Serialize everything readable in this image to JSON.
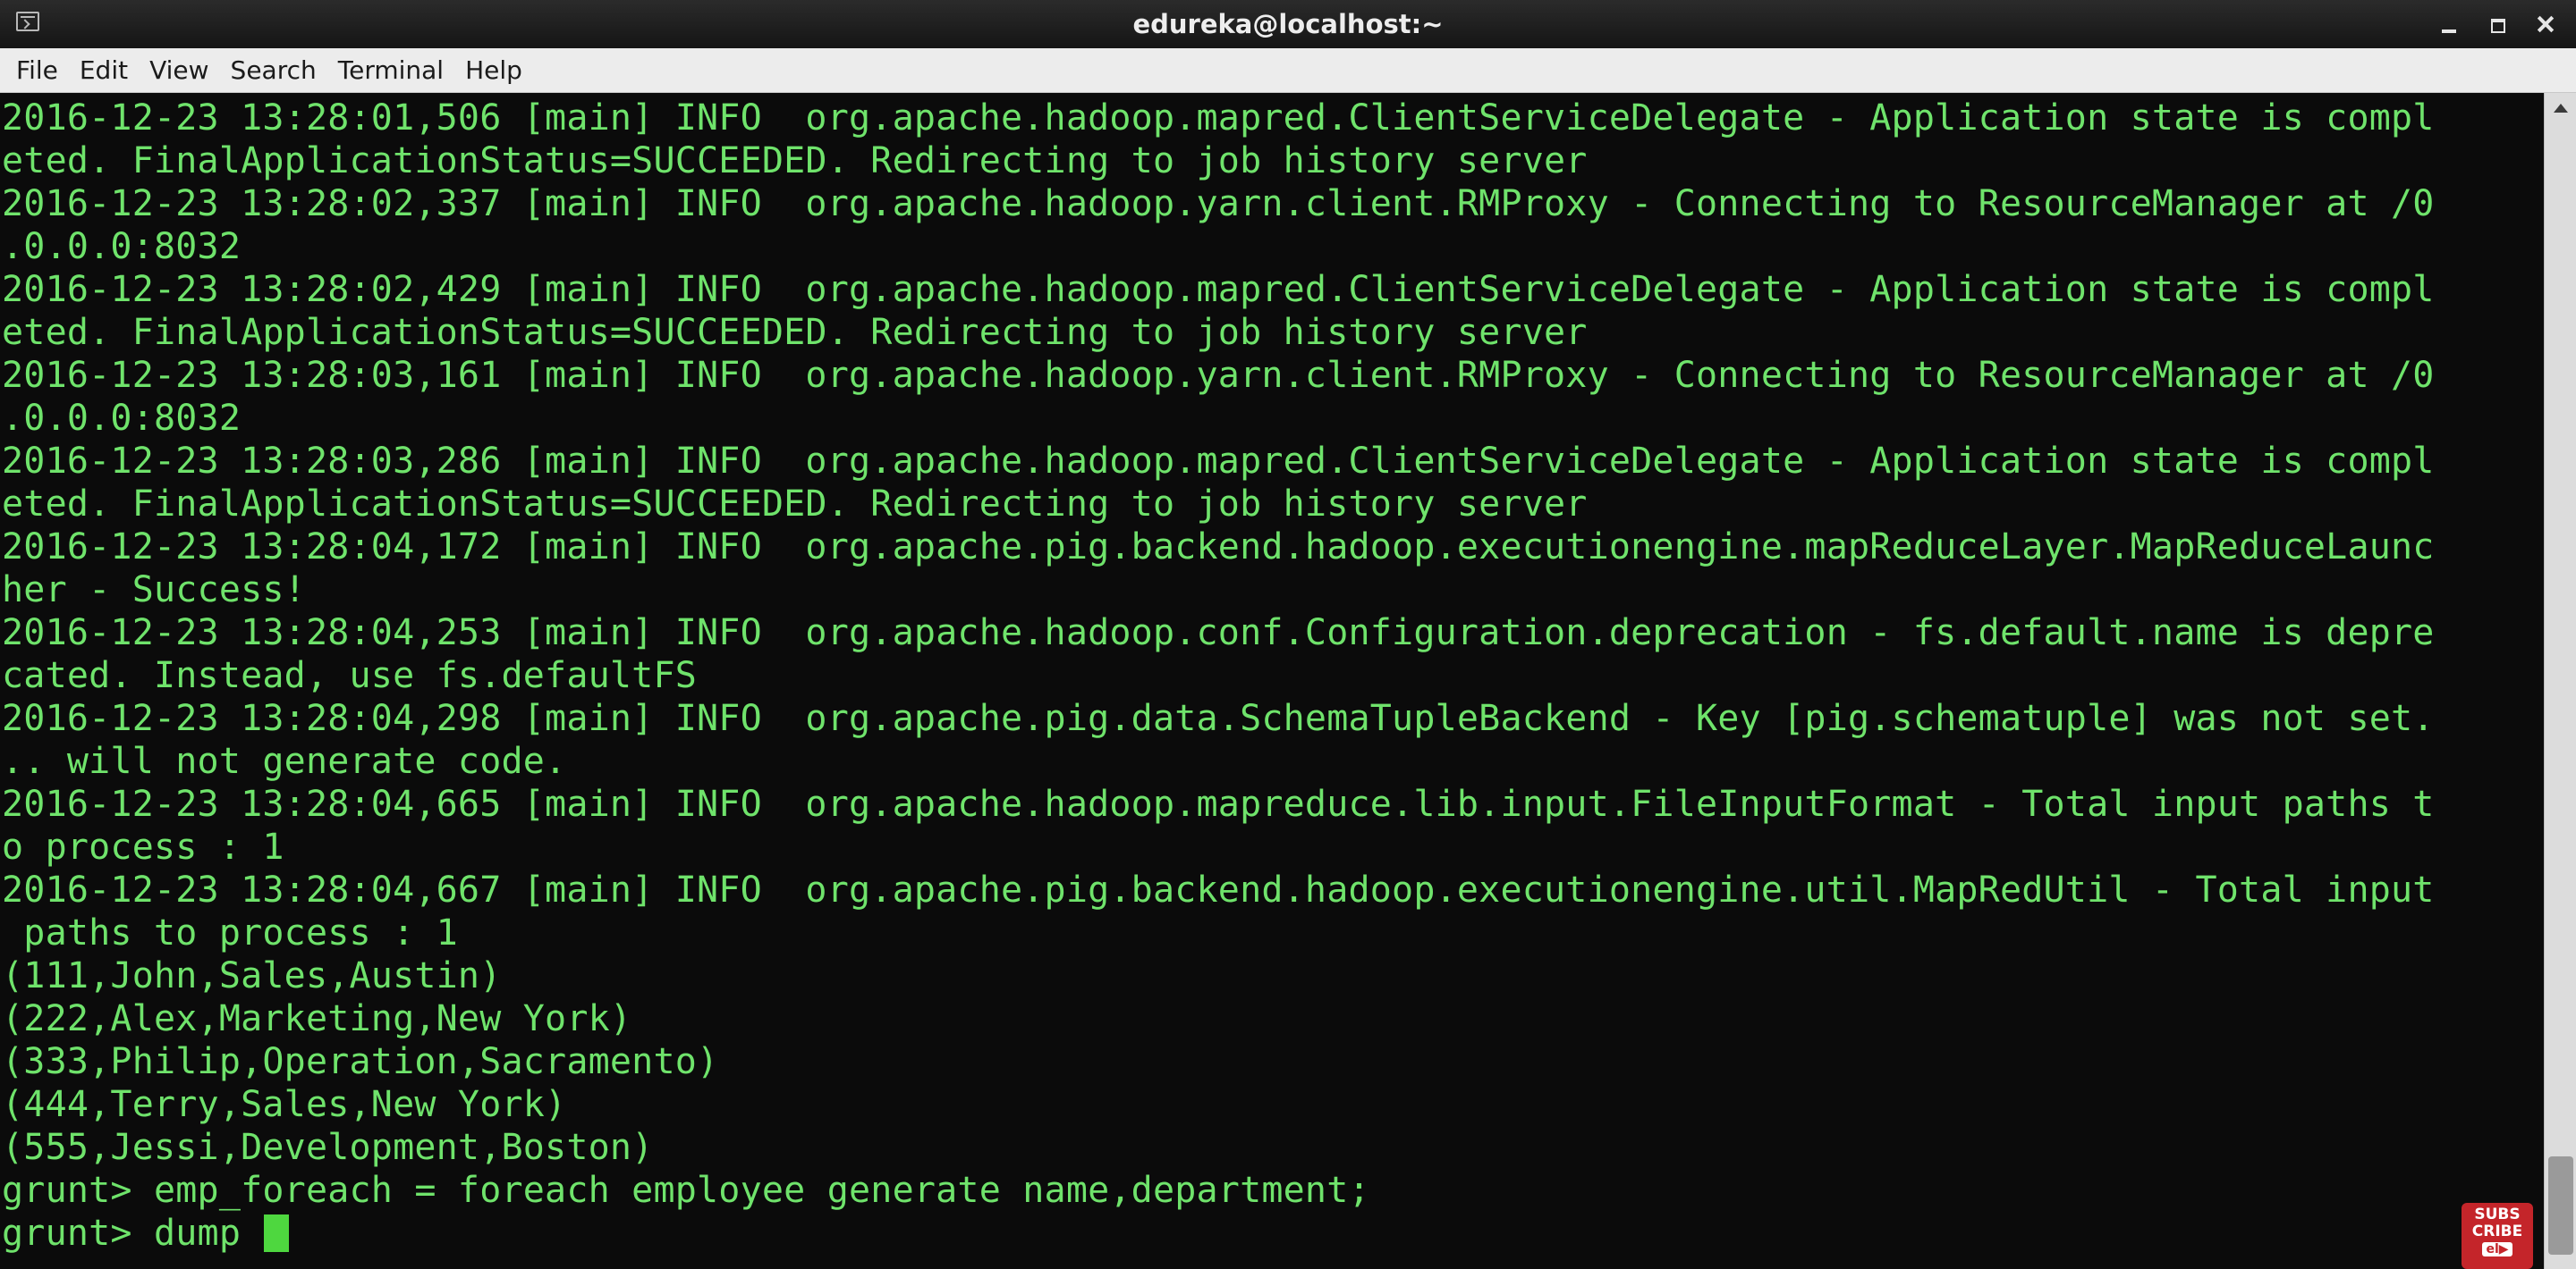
{
  "window": {
    "title": "edureka@localhost:~"
  },
  "menu": [
    "File",
    "Edit",
    "View",
    "Search",
    "Terminal",
    "Help"
  ],
  "terminal": {
    "lines": [
      "2016-12-23 13:28:01,506 [main] INFO  org.apache.hadoop.mapred.ClientServiceDelegate - Application state is compl",
      "eted. FinalApplicationStatus=SUCCEEDED. Redirecting to job history server",
      "2016-12-23 13:28:02,337 [main] INFO  org.apache.hadoop.yarn.client.RMProxy - Connecting to ResourceManager at /0",
      ".0.0.0:8032",
      "2016-12-23 13:28:02,429 [main] INFO  org.apache.hadoop.mapred.ClientServiceDelegate - Application state is compl",
      "eted. FinalApplicationStatus=SUCCEEDED. Redirecting to job history server",
      "2016-12-23 13:28:03,161 [main] INFO  org.apache.hadoop.yarn.client.RMProxy - Connecting to ResourceManager at /0",
      ".0.0.0:8032",
      "2016-12-23 13:28:03,286 [main] INFO  org.apache.hadoop.mapred.ClientServiceDelegate - Application state is compl",
      "eted. FinalApplicationStatus=SUCCEEDED. Redirecting to job history server",
      "2016-12-23 13:28:04,172 [main] INFO  org.apache.pig.backend.hadoop.executionengine.mapReduceLayer.MapReduceLaunc",
      "her - Success!",
      "2016-12-23 13:28:04,253 [main] INFO  org.apache.hadoop.conf.Configuration.deprecation - fs.default.name is depre",
      "cated. Instead, use fs.defaultFS",
      "2016-12-23 13:28:04,298 [main] INFO  org.apache.pig.data.SchemaTupleBackend - Key [pig.schematuple] was not set.",
      ".. will not generate code.",
      "2016-12-23 13:28:04,665 [main] INFO  org.apache.hadoop.mapreduce.lib.input.FileInputFormat - Total input paths t",
      "o process : 1",
      "2016-12-23 13:28:04,667 [main] INFO  org.apache.pig.backend.hadoop.executionengine.util.MapRedUtil - Total input",
      " paths to process : 1",
      "(111,John,Sales,Austin)",
      "(222,Alex,Marketing,New York)",
      "(333,Philip,Operation,Sacramento)",
      "(444,Terry,Sales,New York)",
      "(555,Jessi,Development,Boston)",
      "grunt> emp_foreach = foreach employee generate name,department;"
    ],
    "prompt_line": "grunt> dump "
  },
  "overlay": {
    "subscribe_line1": "SUBS",
    "subscribe_line2": "CRIBE",
    "subscribe_logo": "el▶"
  },
  "colors": {
    "terminal_bg": "#0b0b0b",
    "terminal_text": "#6fe36b",
    "cursor": "#4ed73f",
    "subscribe_bg": "#c4252a"
  }
}
